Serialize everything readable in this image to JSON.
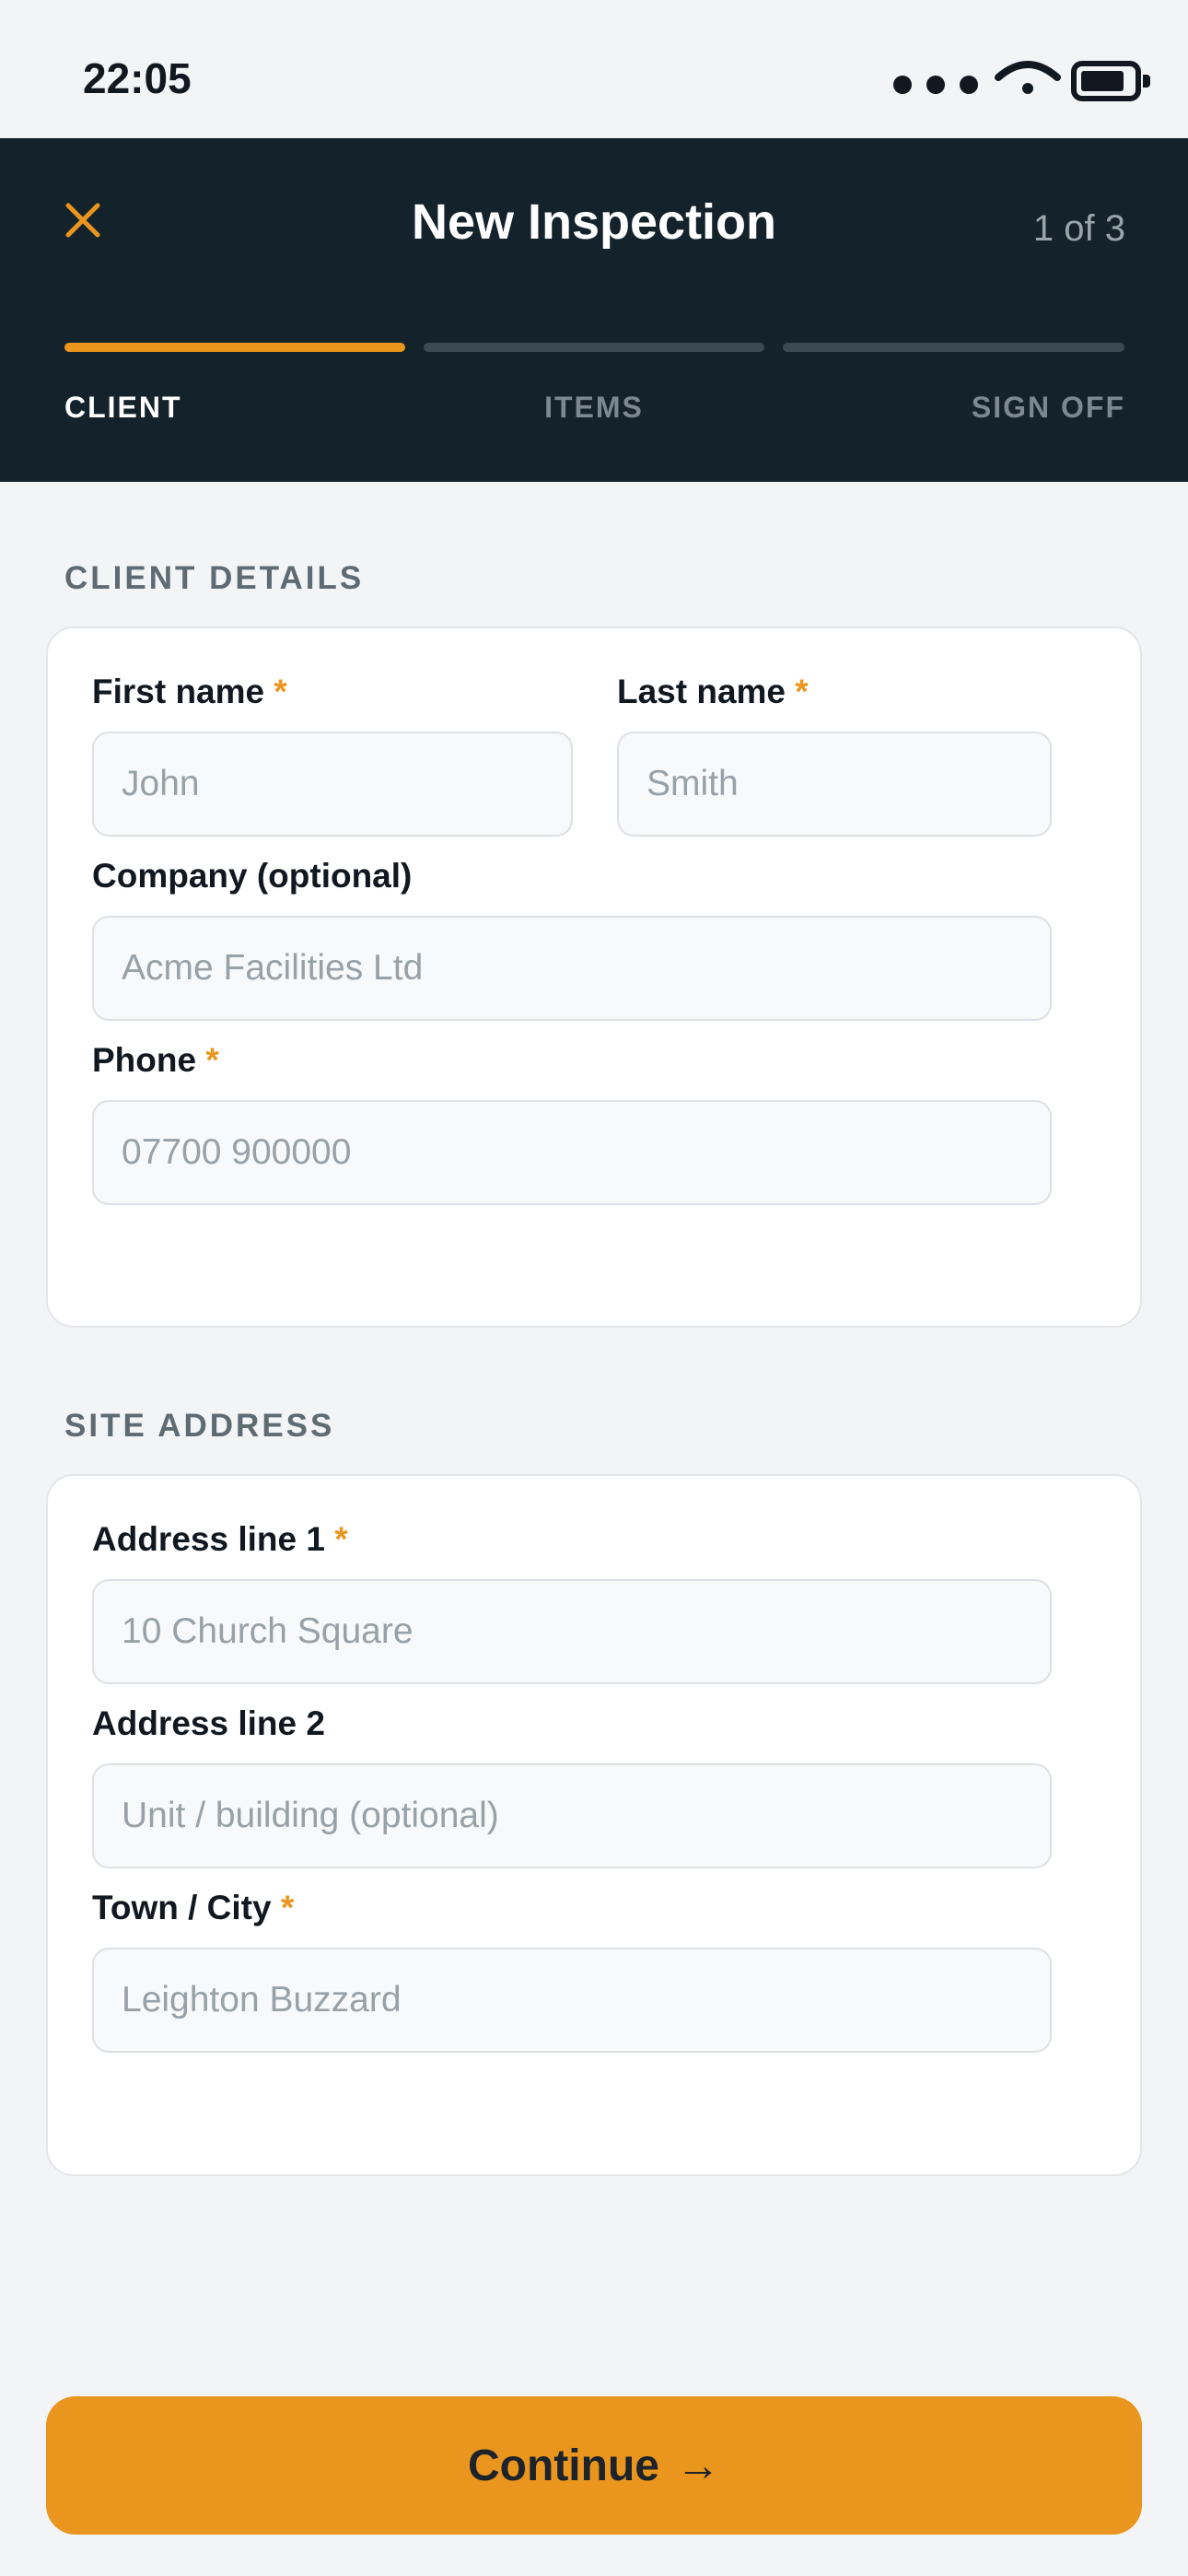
{
  "status_bar": {
    "time": "22:05"
  },
  "header": {
    "title": "New Inspection",
    "step_count": "1 of 3",
    "accent_color": "#e9951e",
    "steps": [
      {
        "label": "CLIENT",
        "active": true
      },
      {
        "label": "ITEMS",
        "active": false
      },
      {
        "label": "SIGN OFF",
        "active": false
      }
    ]
  },
  "client_details": {
    "title": "CLIENT DETAILS",
    "first_name": {
      "label": "First name",
      "required_mark": "*",
      "placeholder": "John"
    },
    "last_name": {
      "label": "Last name",
      "required_mark": "*",
      "placeholder": "Smith"
    },
    "company": {
      "label": "Company (optional)",
      "placeholder": "Acme Facilities Ltd"
    },
    "phone": {
      "label": "Phone",
      "required_mark": "*",
      "placeholder": "07700 900000"
    }
  },
  "site_address": {
    "title": "SITE ADDRESS",
    "address_line_1": {
      "label": "Address line 1",
      "required_mark": "*",
      "placeholder": "10 Church Square"
    },
    "address_line_2": {
      "label": "Address line 2",
      "placeholder": "Unit / building (optional)"
    },
    "town_city": {
      "label": "Town / City",
      "required_mark": "*",
      "placeholder": "Leighton Buzzard"
    }
  },
  "footer": {
    "continue_label": "Continue",
    "continue_arrow": "→"
  }
}
